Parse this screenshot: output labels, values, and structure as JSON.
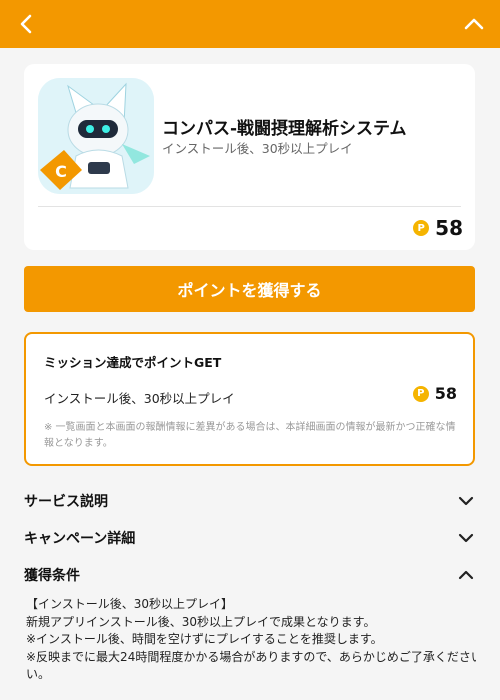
{
  "header": {
    "back_icon": "chevron-left-icon",
    "collapse_icon": "chevron-up-icon",
    "background": "#f39800"
  },
  "app": {
    "name": "コンパス-戦闘摂理解析システム",
    "condition": "インストール後、30秒以上プレイ",
    "points_coin": "P",
    "points": "58"
  },
  "cta": {
    "label": "ポイントを獲得する"
  },
  "mission": {
    "title": "ミッション達成でポイントGET",
    "row_label": "インストール後、30秒以上プレイ",
    "points_coin": "P",
    "points": "58",
    "note": "※ 一覧画面と本画面の報酬情報に差異がある場合は、本詳細画面の情報が最新かつ正確な情報となります。"
  },
  "sections": {
    "service": {
      "label": "サービス説明",
      "state": "collapsed"
    },
    "campaign": {
      "label": "キャンペーン詳細",
      "state": "collapsed"
    },
    "conditions": {
      "label": "獲得条件",
      "state": "expanded",
      "lines": [
        "【インストール後、30秒以上プレイ】",
        "新規アプリインストール後、30秒以上プレイで成果となります。",
        "※インストール後、時間を空けずにプレイすることを推奨します。",
        "※反映までに最大24時間程度かかる場合がありますので、あらかじめご了承ください。",
        "い。"
      ]
    }
  },
  "colors": {
    "accent": "#f39800",
    "coin": "#f5b400",
    "background": "#f5f5f5"
  }
}
